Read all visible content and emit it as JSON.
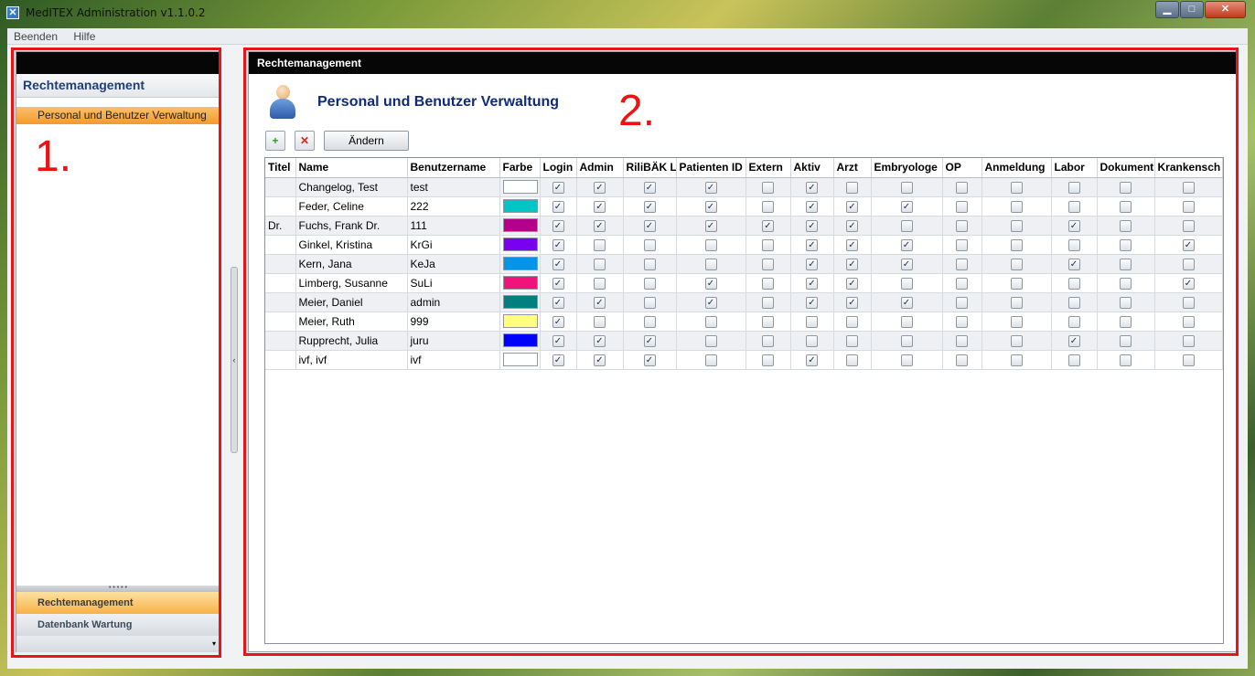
{
  "window": {
    "title": "MedITEX Administration v1.1.0.2",
    "minimize": "▁",
    "maximize": "□",
    "close": "✕"
  },
  "menu": [
    "Beenden",
    "Hilfe"
  ],
  "left": {
    "header": "Rechtemanagement",
    "item": "Personal und Benutzer Verwaltung",
    "grip": "• • • • •",
    "accordion": [
      "Rechtemanagement",
      "Datenbank Wartung"
    ],
    "more": "▾"
  },
  "annotations": {
    "one": "1.",
    "two": "2."
  },
  "splitter": "‹",
  "right": {
    "panel_title": "Rechtemanagement",
    "heading": "Personal und Benutzer Verwaltung",
    "add_button": "+",
    "delete_button": "✕",
    "change_button": "Ändern",
    "columns": [
      "Titel",
      "Name",
      "Benutzername",
      "Farbe",
      "Login",
      "Admin",
      "RiliBÄK La",
      "Patienten ID",
      "Extern",
      "Aktiv",
      "Arzt",
      "Embryologe",
      "OP",
      "Anmeldung",
      "Labor",
      "Dokument",
      "Krankensch"
    ],
    "rows": [
      {
        "titel": "",
        "name": "Changelog, Test",
        "user": "test",
        "color": "#ffffff",
        "flags": [
          1,
          1,
          1,
          1,
          0,
          1,
          0,
          0,
          0,
          0,
          0,
          0,
          0
        ]
      },
      {
        "titel": "",
        "name": "Feder, Celine",
        "user": "222",
        "color": "#00c5c5",
        "flags": [
          1,
          1,
          1,
          1,
          0,
          1,
          1,
          1,
          0,
          0,
          0,
          0,
          0
        ]
      },
      {
        "titel": "Dr.",
        "name": "Fuchs, Frank Dr.",
        "user": "111",
        "color": "#b5008a",
        "flags": [
          1,
          1,
          1,
          1,
          1,
          1,
          1,
          0,
          0,
          0,
          1,
          0,
          0
        ]
      },
      {
        "titel": "",
        "name": "Ginkel, Kristina",
        "user": "KrGi",
        "color": "#7a00f0",
        "flags": [
          1,
          0,
          0,
          0,
          0,
          1,
          1,
          1,
          0,
          0,
          0,
          0,
          1
        ]
      },
      {
        "titel": "",
        "name": "Kern, Jana",
        "user": "KeJa",
        "color": "#0095e8",
        "flags": [
          1,
          0,
          0,
          0,
          0,
          1,
          1,
          1,
          0,
          0,
          1,
          0,
          0
        ]
      },
      {
        "titel": "",
        "name": "Limberg, Susanne",
        "user": "SuLi",
        "color": "#f0147a",
        "flags": [
          1,
          0,
          0,
          1,
          0,
          1,
          1,
          0,
          0,
          0,
          0,
          0,
          1
        ]
      },
      {
        "titel": "",
        "name": "Meier, Daniel",
        "user": "admin",
        "color": "#007f7f",
        "flags": [
          1,
          1,
          0,
          1,
          0,
          1,
          1,
          1,
          0,
          0,
          0,
          0,
          0
        ]
      },
      {
        "titel": "",
        "name": "Meier, Ruth",
        "user": "999",
        "color": "#ffff80",
        "flags": [
          1,
          0,
          0,
          0,
          0,
          0,
          0,
          0,
          0,
          0,
          0,
          0,
          0
        ]
      },
      {
        "titel": "",
        "name": "Rupprecht, Julia",
        "user": "juru",
        "color": "#0000ff",
        "flags": [
          1,
          1,
          1,
          0,
          0,
          0,
          0,
          0,
          0,
          0,
          1,
          0,
          0
        ]
      },
      {
        "titel": "",
        "name": "ivf, ivf",
        "user": "ivf",
        "color": "#ffffff",
        "flags": [
          1,
          1,
          1,
          0,
          0,
          1,
          0,
          0,
          0,
          0,
          0,
          0,
          0
        ]
      }
    ]
  }
}
